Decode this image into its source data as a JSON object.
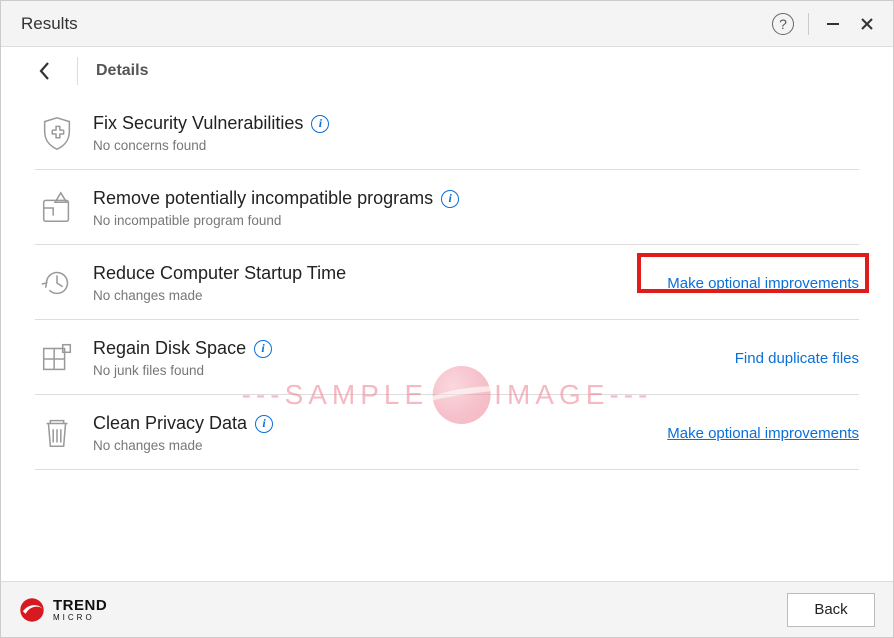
{
  "window": {
    "title": "Results"
  },
  "subheader": {
    "crumb": "Details"
  },
  "rows": [
    {
      "title": "Fix Security Vulnerabilities",
      "sub": "No concerns found",
      "info": true,
      "action": ""
    },
    {
      "title": "Remove potentially incompatible programs",
      "sub": "No incompatible program found",
      "info": true,
      "action": ""
    },
    {
      "title": "Reduce Computer Startup Time",
      "sub": "No changes made",
      "info": false,
      "action": "Make optional improvements"
    },
    {
      "title": "Regain Disk Space",
      "sub": "No junk files found",
      "info": true,
      "action": "Find duplicate files"
    },
    {
      "title": "Clean Privacy Data",
      "sub": "No changes made",
      "info": true,
      "action": "Make optional improvements"
    }
  ],
  "footer": {
    "brand1": "TREND",
    "brand2": "MICRO",
    "back": "Back"
  },
  "watermark": {
    "left": "---SAMPLE",
    "right": "IMAGE---"
  }
}
